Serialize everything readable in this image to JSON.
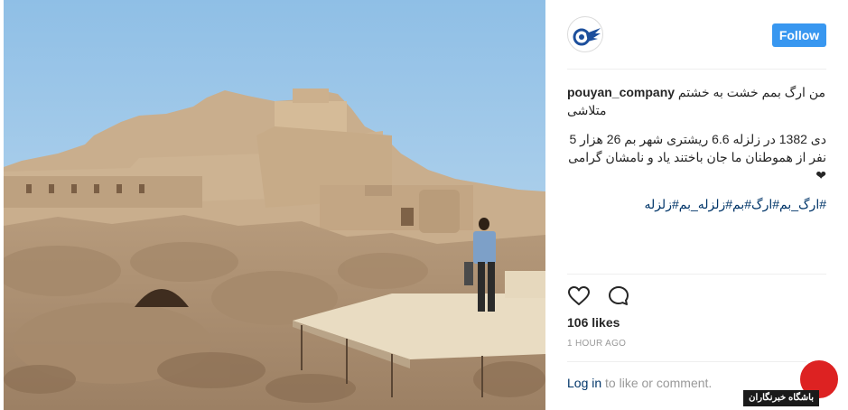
{
  "account": {
    "username": "pouyan_company",
    "follow_label": "Follow"
  },
  "caption": {
    "line1_text": "من ارگ بمم خشت به خشتم متلاشی",
    "line2_text": "دی 1382 در زلزله 6.6 ریشتری شهر بم 26 هزار 5 نفر از هموطنان ما جان باختند یاد و نامشان گرامی",
    "heart_emoji": "❤",
    "hashtags": "#ارگ_بم#ارگ#بم#زلزله_بم#زلزله"
  },
  "engagement": {
    "likes": "106 likes",
    "timestamp": "1 HOUR AGO"
  },
  "comment_prompt": {
    "login_label": "Log in",
    "rest_text": " to like or comment."
  },
  "actions": {
    "like_icon": "heart-outline-icon",
    "comment_icon": "speech-bubble-icon"
  },
  "watermark": {
    "text": "باشگاه خبرنگاران"
  },
  "colors": {
    "follow_button": "#3897f0",
    "link": "#003569",
    "muted": "#999999",
    "sky": "#a9cde9"
  }
}
